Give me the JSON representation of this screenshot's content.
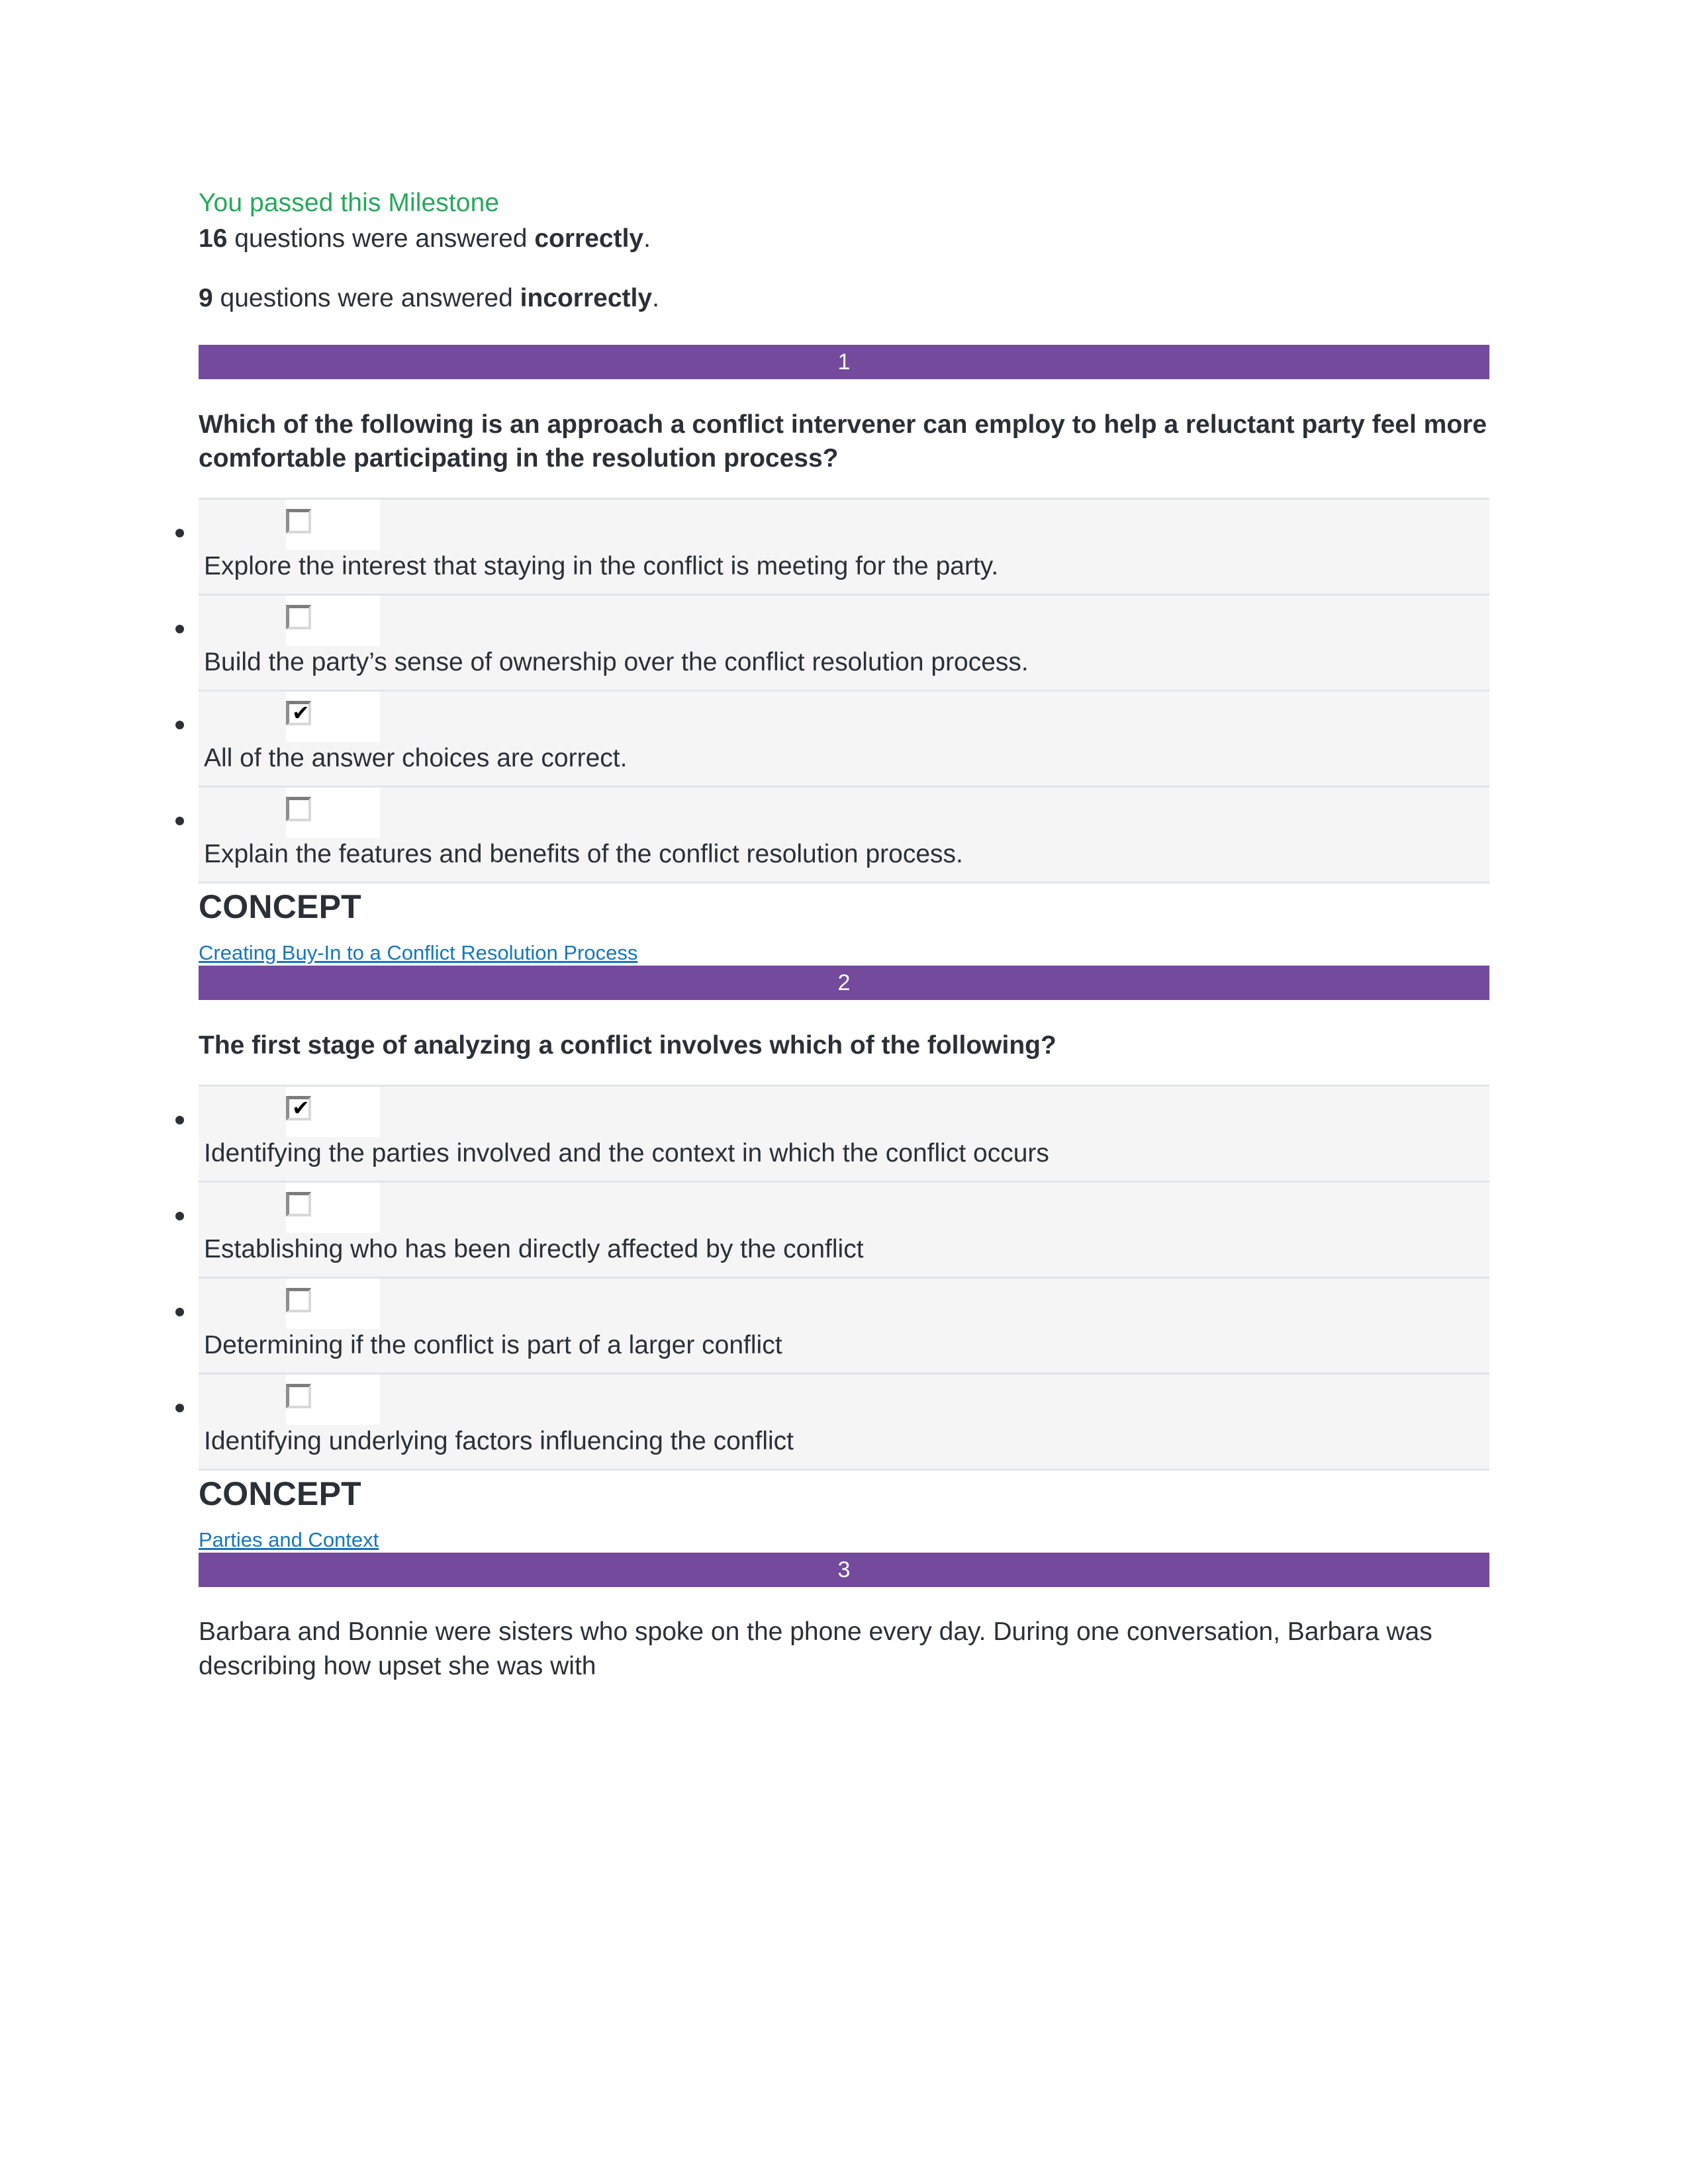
{
  "result": {
    "pass_message": "You passed this Milestone",
    "correct_count": "16",
    "correct_text_mid": " questions were answered ",
    "correct_label": "correctly",
    "correct_period": ".",
    "incorrect_count": "9",
    "incorrect_text_mid": " questions were answered ",
    "incorrect_label": "incorrectly",
    "incorrect_period": "."
  },
  "colors": {
    "banner_purple": "#744a9c",
    "pass_green": "#27a85b",
    "link_blue": "#1577bc",
    "row_gray": "#f5f5f6",
    "row_border": "#e2e4e8",
    "text": "#2b3036"
  },
  "labels": {
    "concept_heading": "CONCEPT"
  },
  "questions": [
    {
      "number": "1",
      "prompt": "Which of the following is an approach a conflict intervener can employ to help a reluctant party feel more comfortable participating in the resolution process?",
      "answers": [
        {
          "text": "Explore the interest that staying in the conflict is meeting for the party.",
          "checked": false,
          "check_glyph": ""
        },
        {
          "text": "Build the party’s sense of ownership over the conflict resolution process.",
          "checked": false,
          "check_glyph": ""
        },
        {
          "text": "All of the answer choices are correct.",
          "checked": true,
          "check_glyph": "✔"
        },
        {
          "text": "Explain the features and benefits of the conflict resolution process.",
          "checked": false,
          "check_glyph": ""
        }
      ],
      "concept_heading": "CONCEPT",
      "concept_link": "Creating Buy-In to a Conflict Resolution Process"
    },
    {
      "number": "2",
      "prompt": "The first stage of analyzing a conflict involves which of the following?",
      "answers": [
        {
          "text": "Identifying the parties involved and the context in which the conflict occurs",
          "checked": true,
          "check_glyph": "✔"
        },
        {
          "text": "Establishing who has been directly affected by the conflict",
          "checked": false,
          "check_glyph": ""
        },
        {
          "text": "Determining if the conflict is part of a larger conflict",
          "checked": false,
          "check_glyph": ""
        },
        {
          "text": "Identifying underlying factors influencing the conflict",
          "checked": false,
          "check_glyph": ""
        }
      ],
      "concept_heading": "CONCEPT",
      "concept_link": "Parties and Context"
    },
    {
      "number": "3",
      "prompt": "Barbara and Bonnie were sisters who spoke on the phone every day. During one conversation, Barbara was describing how upset she was with",
      "answers": [],
      "concept_heading": "",
      "concept_link": ""
    }
  ]
}
